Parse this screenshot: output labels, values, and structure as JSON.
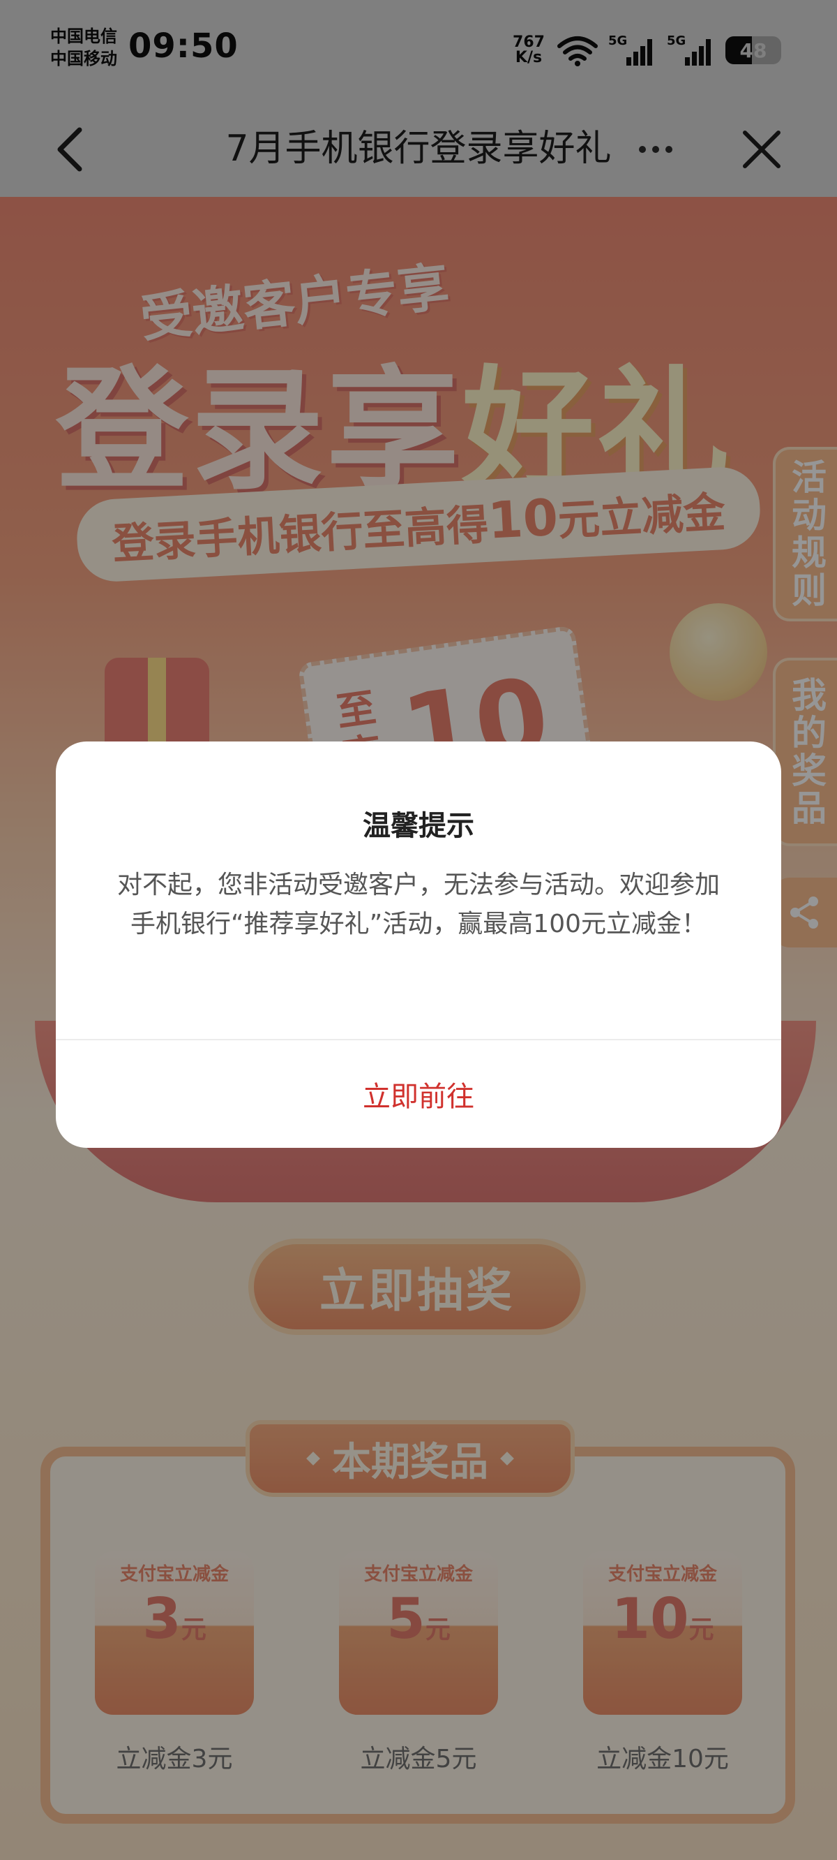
{
  "status_bar": {
    "carrier_1": "中国电信",
    "carrier_2": "中国移动",
    "time": "09:50",
    "net_speed_value": "767",
    "net_speed_unit": "K/s",
    "signal_1_label": "5G",
    "signal_2_label": "5G",
    "battery_level": "48",
    "battery_fraction": 0.48
  },
  "nav": {
    "title": "7月手机银行登录享好礼",
    "back_icon": "chevron-left-icon",
    "more_icon": "more-dots-icon",
    "close_icon": "close-icon"
  },
  "hero": {
    "tagline": "受邀客户专享",
    "title_main": "登录享",
    "title_accent": "好礼",
    "ribbon_prefix": "登录手机银行至高得",
    "ribbon_amount": "10",
    "ribbon_suffix": "元立减金",
    "coupon_text": "至高",
    "coupon_amount": "10"
  },
  "side_tabs": {
    "rules": "活动规则",
    "prizes": "我的奖品",
    "share_icon": "share-icon"
  },
  "draw_button": "立即抽奖",
  "prizes": {
    "header": "本期奖品",
    "items": [
      {
        "card_label": "支付宝立减金",
        "value": "3",
        "unit": "元",
        "caption": "立减金3元"
      },
      {
        "card_label": "支付宝立减金",
        "value": "5",
        "unit": "元",
        "caption": "立减金5元"
      },
      {
        "card_label": "支付宝立减金",
        "value": "10",
        "unit": "元",
        "caption": "立减金10元"
      }
    ]
  },
  "dialog": {
    "title": "温馨提示",
    "message": "对不起，您非活动受邀客户，无法参与活动。欢迎参加手机银行“推荐享好礼”活动，赢最高100元立减金！",
    "button": "立即前往"
  },
  "colors": {
    "accent_red": "#d0312d",
    "hero_orange": "#e85a3a",
    "panel_orange": "#f2a266"
  }
}
